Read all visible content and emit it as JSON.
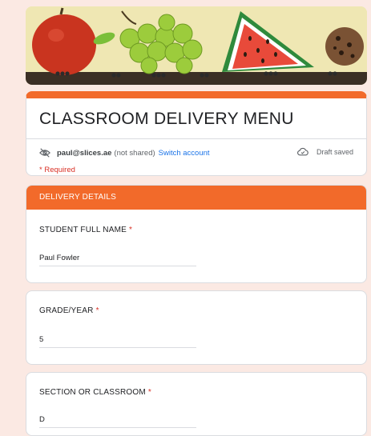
{
  "form": {
    "title": "CLASSROOM DELIVERY MENU",
    "account": {
      "email": "paul@slices.ae",
      "shared_note": "(not shared)",
      "switch_label": "Switch account",
      "status_icon": "eye-off-icon"
    },
    "draft_status": "Draft saved",
    "required_note": "* Required",
    "accent_color": "#f26a2a"
  },
  "section": {
    "header": "DELIVERY DETAILS"
  },
  "questions": [
    {
      "label": "STUDENT FULL NAME",
      "required_mark": "*",
      "value": "Paul Fowler"
    },
    {
      "label": "GRADE/YEAR",
      "required_mark": "*",
      "value": "5"
    },
    {
      "label": "SECTION OR CLASSROOM",
      "required_mark": "*",
      "value": "D"
    }
  ]
}
